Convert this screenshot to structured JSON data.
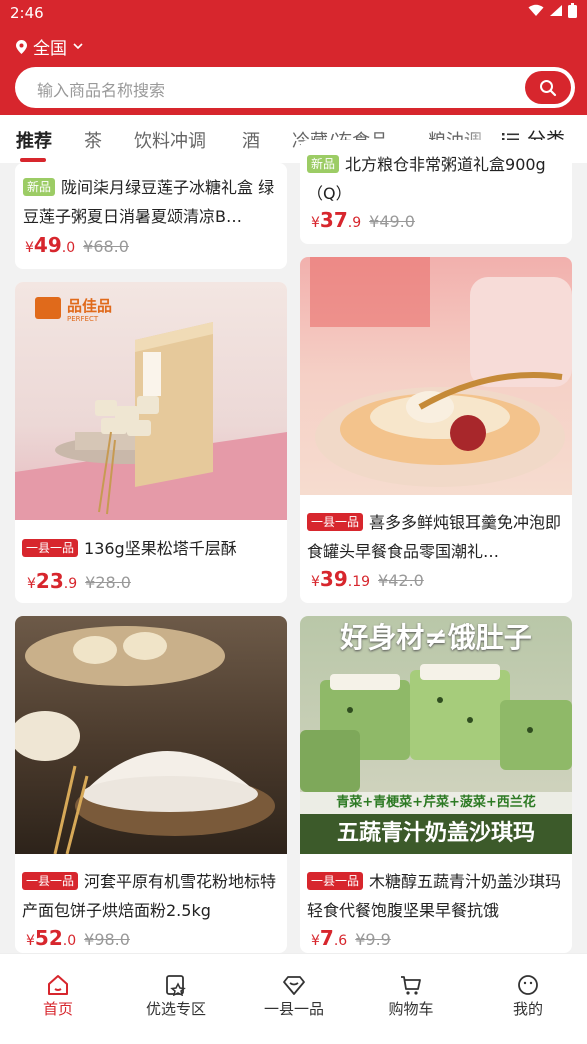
{
  "status": {
    "time": "2:46"
  },
  "location": {
    "label": "全国"
  },
  "search": {
    "placeholder": "输入商品名称搜索"
  },
  "tabs": [
    "推荐",
    "茶",
    "饮料冲调",
    "酒",
    "冷藏/冻食品",
    "粮油调"
  ],
  "category_label": "分类",
  "products": [
    {
      "tag": "新品",
      "title": "陇间柒月绿豆莲子冰糖礼盒 绿豆莲子粥夏日消暑夏颂清凉B…",
      "price_int": "49",
      "price_dec": ".0",
      "old_price": "68.0"
    },
    {
      "tag": "新品",
      "title": "北方粮仓非常粥道礼盒900g（Q）",
      "price_int": "37",
      "price_dec": ".9",
      "old_price": "49.0"
    },
    {
      "tag": "一县一品",
      "title": "136g坚果松塔千层酥",
      "price_int": "23",
      "price_dec": ".9",
      "old_price": "28.0",
      "brand": "品佳品",
      "brand_en": "PERFECT"
    },
    {
      "tag": "一县一品",
      "title": "喜多多鲜炖银耳羹免冲泡即食罐头早餐食品零国潮礼…",
      "price_int": "39",
      "price_dec": ".19",
      "old_price": "42.0"
    },
    {
      "tag": "一县一品",
      "title": "河套平原有机雪花粉地标特产面包饼子烘焙面粉2.5kg",
      "price_int": "52",
      "price_dec": ".0",
      "old_price": "98.0"
    },
    {
      "tag": "一县一品",
      "title": "木糖醇五蔬青汁奶盖沙琪玛轻食代餐饱腹坚果早餐抗饿",
      "price_int": "7",
      "price_dec": ".6",
      "old_price": "9.9",
      "img_top": "好身材≠饿肚子",
      "img_veg": "青菜+青梗菜+芹菜+菠菜+西兰花",
      "img_bottom": "五蔬青汁奶盖沙琪玛"
    }
  ],
  "currency": "¥",
  "bottom_nav": [
    "首页",
    "优选专区",
    "一县一品",
    "购物车",
    "我的"
  ],
  "colors": {
    "brand": "#d7262d",
    "new_tag": "#9ccc65"
  }
}
